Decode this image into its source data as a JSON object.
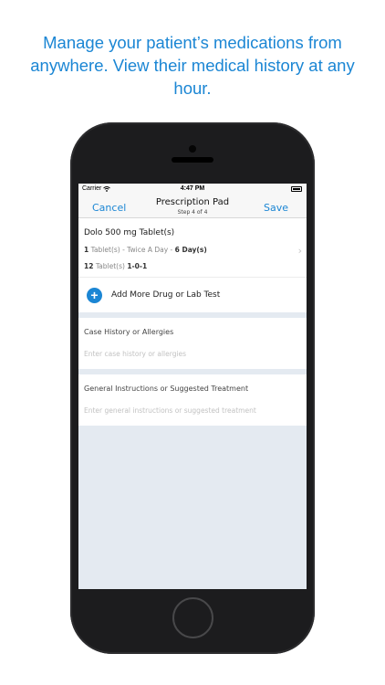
{
  "headline": {
    "line1": "Manage your patient’s medications from",
    "line2": "anywhere. View their medical history at any",
    "line3": "hour."
  },
  "status_bar": {
    "carrier": "Carrier",
    "time": "4:47 PM"
  },
  "nav": {
    "cancel_label": "Cancel",
    "title": "Prescription Pad",
    "step": "Step 4 of 4",
    "save_label": "Save"
  },
  "drug": {
    "name": "Dolo 500 mg Tablet(s)",
    "dose_qty": "1",
    "dose_unit": " Tablet(s) - Twice A Day - ",
    "duration": "6 Day(s)",
    "total_qty": "12",
    "total_unit": " Tablet(s) ",
    "schedule": "1-0-1"
  },
  "add_more": {
    "label": "Add More Drug or Lab Test"
  },
  "case_history": {
    "label": "Case History or Allergies",
    "placeholder": "Enter case history or allergies"
  },
  "instructions": {
    "label": "General Instructions or Suggested Treatment",
    "placeholder": "Enter general instructions or suggested treatment"
  },
  "colors": {
    "accent": "#1b86d4",
    "background": "#e4eaf1",
    "phone_body": "#1c1c1e"
  }
}
